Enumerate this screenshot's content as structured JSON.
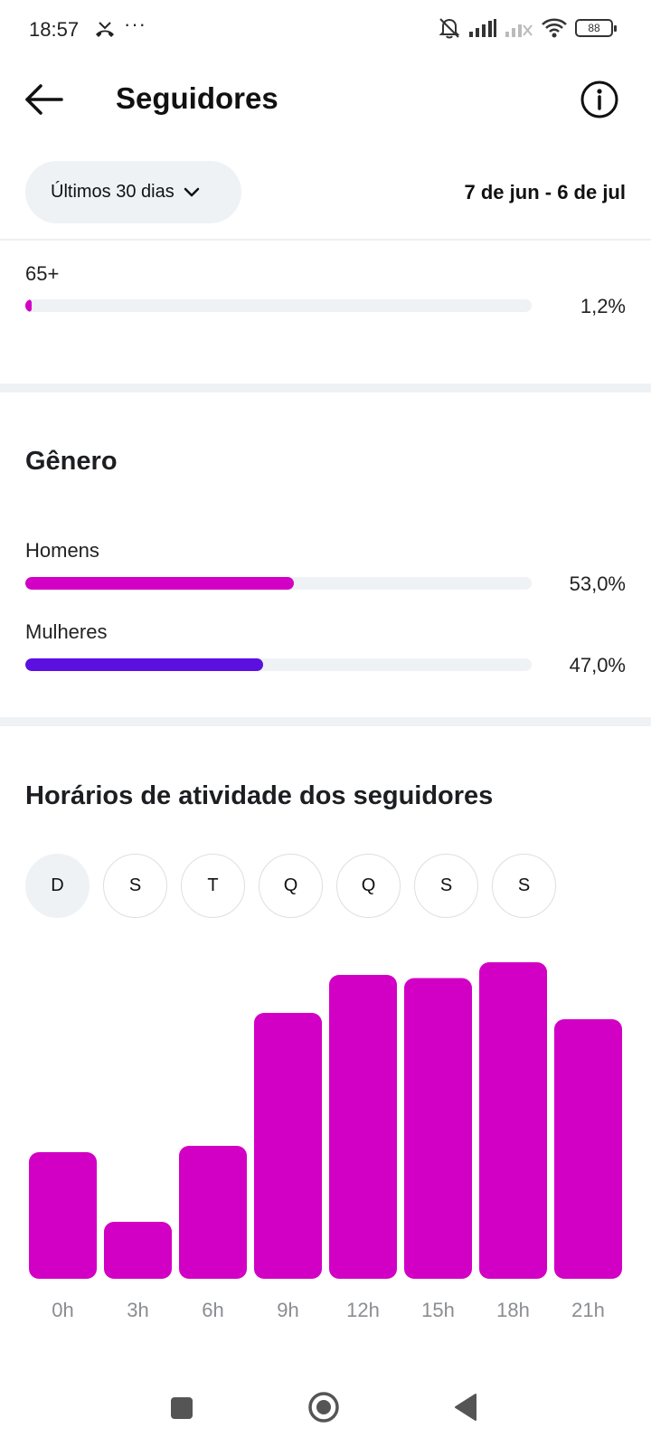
{
  "status_bar": {
    "time": "18:57",
    "dots": "···",
    "battery": "88"
  },
  "header": {
    "title": "Seguidores"
  },
  "filter": {
    "period_label": "Últimos 30 dias",
    "date_range": "7 de jun - 6 de jul"
  },
  "age": {
    "label": "65+",
    "percent_text": "1,2%",
    "value": 1.2,
    "color": "#d200c4"
  },
  "gender": {
    "title": "Gênero",
    "items": [
      {
        "label": "Homens",
        "percent_text": "53,0%",
        "value": 53.0,
        "color": "#d200c4"
      },
      {
        "label": "Mulheres",
        "percent_text": "47,0%",
        "value": 47.0,
        "color": "#5b10e0"
      }
    ]
  },
  "activity": {
    "title": "Horários de atividade dos seguidores",
    "days": [
      "D",
      "S",
      "T",
      "Q",
      "Q",
      "S",
      "S"
    ],
    "selected_day_index": 0
  },
  "colors": {
    "accent": "#d200c4",
    "secondary": "#5b10e0",
    "track": "#eff2f5"
  },
  "chart_data": {
    "type": "bar",
    "categories": [
      "0h",
      "3h",
      "6h",
      "9h",
      "12h",
      "15h",
      "18h",
      "21h"
    ],
    "values": [
      40,
      18,
      42,
      84,
      96,
      95,
      100,
      82
    ],
    "ylim": [
      0,
      100
    ],
    "color": "#d200c4",
    "grid": false
  }
}
